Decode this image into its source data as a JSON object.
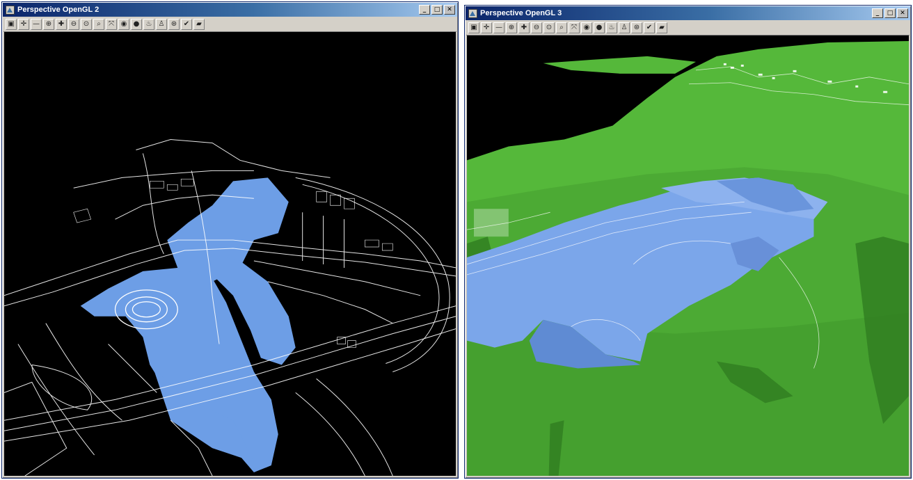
{
  "windows": {
    "left": {
      "title": "Perspective OpenGL 2",
      "view_mode": "wireframe with shaded water",
      "colors": {
        "background": "#000000",
        "linework": "#ffffff",
        "water": "#6d9ee6"
      }
    },
    "right": {
      "title": "Perspective OpenGL 3",
      "view_mode": "shaded terrain",
      "colors": {
        "sky": "#000000",
        "terrain": "#55b83a",
        "water": "#7ba6ea"
      }
    }
  },
  "title_buttons": [
    {
      "name": "minimize",
      "glyph": "_"
    },
    {
      "name": "maximize",
      "glyph": "□"
    },
    {
      "name": "close",
      "glyph": "✕"
    }
  ],
  "toolbar_icons": [
    {
      "name": "view-window-icon",
      "glyph": "▣"
    },
    {
      "name": "pan-icon",
      "glyph": "✛"
    },
    {
      "name": "dolly-icon",
      "glyph": "—"
    },
    {
      "name": "zoom-in-icon",
      "glyph": "⊕"
    },
    {
      "name": "fit-view-icon",
      "glyph": "✚"
    },
    {
      "name": "zoom-out-icon",
      "glyph": "⊖"
    },
    {
      "name": "zoom-window-icon",
      "glyph": "⊙"
    },
    {
      "name": "zoom-previous-icon",
      "glyph": "⌕"
    },
    {
      "name": "rotate-view-icon",
      "glyph": "⤧"
    },
    {
      "name": "render-icon",
      "glyph": "◉"
    },
    {
      "name": "material-icon",
      "glyph": "●"
    },
    {
      "name": "light-icon",
      "glyph": "♨"
    },
    {
      "name": "walk-icon",
      "glyph": "♙"
    },
    {
      "name": "steering-icon",
      "glyph": "⊛"
    },
    {
      "name": "camera-target-icon",
      "glyph": "✔"
    },
    {
      "name": "save-view-icon",
      "glyph": "▰"
    }
  ]
}
